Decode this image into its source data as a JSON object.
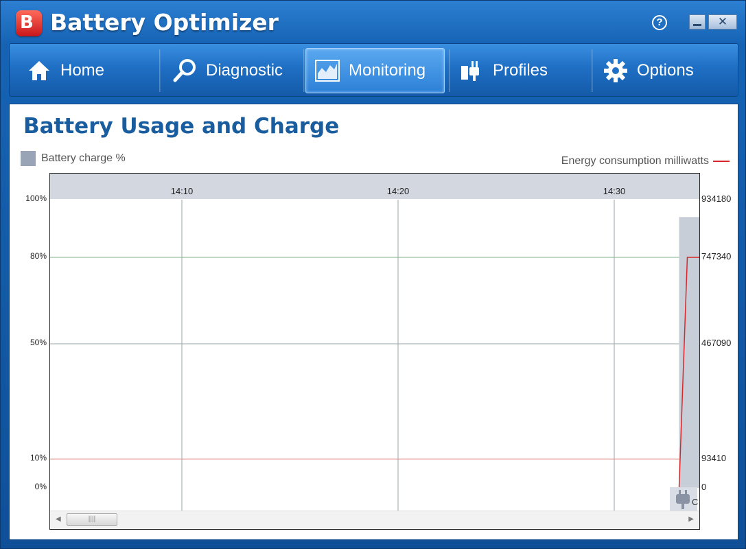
{
  "window": {
    "title": "Battery Optimizer",
    "logo_letter": "B",
    "help_label": "?",
    "close_label": "✕"
  },
  "nav": {
    "items": [
      {
        "label": "Home",
        "icon": "home-icon"
      },
      {
        "label": "Diagnostic",
        "icon": "magnifier-icon"
      },
      {
        "label": "Monitoring",
        "icon": "chart-icon",
        "active": true
      },
      {
        "label": "Profiles",
        "icon": "plug-icon"
      },
      {
        "label": "Options",
        "icon": "gear-icon"
      }
    ]
  },
  "main": {
    "title": "Battery Usage and Charge",
    "legend_left": "Battery charge %",
    "legend_right": "Energy consumption milliwatts",
    "scroll_thumb_label": "||||",
    "cut_label": "C"
  },
  "colors": {
    "accent": "#1a5d9e",
    "charge_fill": "#c8ced8",
    "energy_line": "#d9262a"
  },
  "chart_data": {
    "type": "area",
    "x_ticks": [
      "14:10",
      "14:20",
      "14:30"
    ],
    "y_left_ticks": [
      "100%",
      "80%",
      "50%",
      "10%",
      "0%"
    ],
    "y_left_values": [
      100,
      80,
      50,
      10,
      0
    ],
    "y_right_ticks": [
      "934180",
      "747340",
      "467090",
      "93410",
      "0"
    ],
    "ylim_left": [
      0,
      100
    ],
    "ylim_right": [
      0,
      934180
    ],
    "series": [
      {
        "name": "Battery charge %",
        "kind": "area",
        "x": [
          "14:33",
          "14:34"
        ],
        "values": [
          94,
          94
        ]
      },
      {
        "name": "Energy consumption milliwatts",
        "kind": "line",
        "x": [
          "14:33",
          "14:33",
          "14:34"
        ],
        "values": [
          0,
          747340,
          747340
        ]
      }
    ],
    "grid": true
  }
}
